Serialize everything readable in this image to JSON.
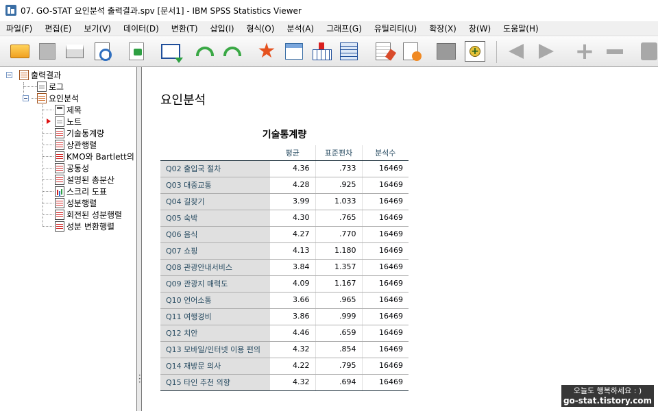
{
  "window": {
    "title": "07. GO-STAT 요인분석 출력결과.spv [문서1] - IBM SPSS Statistics Viewer"
  },
  "menu": [
    "파일(F)",
    "편집(E)",
    "보기(V)",
    "데이터(D)",
    "변환(T)",
    "삽입(I)",
    "형식(O)",
    "분석(A)",
    "그래프(G)",
    "유틸리티(U)",
    "확장(X)",
    "창(W)",
    "도움말(H)"
  ],
  "toolbar": {
    "icons": [
      "open-folder-icon",
      "save-icon",
      "print-icon",
      "print-preview-icon",
      "export-icon",
      "recall-dialog-icon",
      "undo-icon",
      "redo-icon",
      "goto-output-icon",
      "goto-data-icon",
      "insert-output-icon",
      "pivot-table-icon",
      "insert-text-icon",
      "insert-script-icon",
      "disabled-icon",
      "add-icon",
      "back-arrow-icon",
      "forward-arrow-icon",
      "expand-plus-icon",
      "collapse-minus-icon",
      "camera-icon"
    ]
  },
  "tree": {
    "root": "출력결과",
    "log": "로그",
    "analysis": "요인분석",
    "children": [
      "제목",
      "노트",
      "기술통계량",
      "상관행렬",
      "KMO와 Bartlett의 검",
      "공통성",
      "설명된 총분산",
      "스크리 도표",
      "성분행렬",
      "회전된 성분행렬",
      "성분 변환행렬"
    ],
    "current_index": 1
  },
  "content": {
    "heading": "요인분석",
    "table_title": "기술통계량",
    "columns": [
      "평균",
      "표준편차",
      "분석수"
    ],
    "rows": [
      {
        "label": "Q02 출입국 절차",
        "mean": "4.36",
        "sd": ".733",
        "n": "16469"
      },
      {
        "label": "Q03 대중교통",
        "mean": "4.28",
        "sd": ".925",
        "n": "16469"
      },
      {
        "label": "Q04 길찾기",
        "mean": "3.99",
        "sd": "1.033",
        "n": "16469"
      },
      {
        "label": "Q05 숙박",
        "mean": "4.30",
        "sd": ".765",
        "n": "16469"
      },
      {
        "label": "Q06 음식",
        "mean": "4.27",
        "sd": ".770",
        "n": "16469"
      },
      {
        "label": "Q07 쇼핑",
        "mean": "4.13",
        "sd": "1.180",
        "n": "16469"
      },
      {
        "label": "Q08 관광안내서비스",
        "mean": "3.84",
        "sd": "1.357",
        "n": "16469"
      },
      {
        "label": "Q09 관광지 매력도",
        "mean": "4.09",
        "sd": "1.167",
        "n": "16469"
      },
      {
        "label": "Q10 언어소통",
        "mean": "3.66",
        "sd": ".965",
        "n": "16469"
      },
      {
        "label": "Q11 여행경비",
        "mean": "3.86",
        "sd": ".999",
        "n": "16469"
      },
      {
        "label": "Q12 치안",
        "mean": "4.46",
        "sd": ".659",
        "n": "16469"
      },
      {
        "label": "Q13 모바일/인터넷 이용 편의",
        "mean": "4.32",
        "sd": ".854",
        "n": "16469"
      },
      {
        "label": "Q14 재방문 의사",
        "mean": "4.22",
        "sd": ".795",
        "n": "16469"
      },
      {
        "label": "Q15 타인 추천 의향",
        "mean": "4.32",
        "sd": ".694",
        "n": "16469"
      }
    ]
  },
  "watermark": {
    "line1": "오늘도 행복하세요 : )",
    "line2": "go-stat.tistory.com"
  },
  "colors": {
    "row_label_bg": "#e0e0e0",
    "label_text": "#264a60",
    "current_arrow": "#dd1111"
  }
}
